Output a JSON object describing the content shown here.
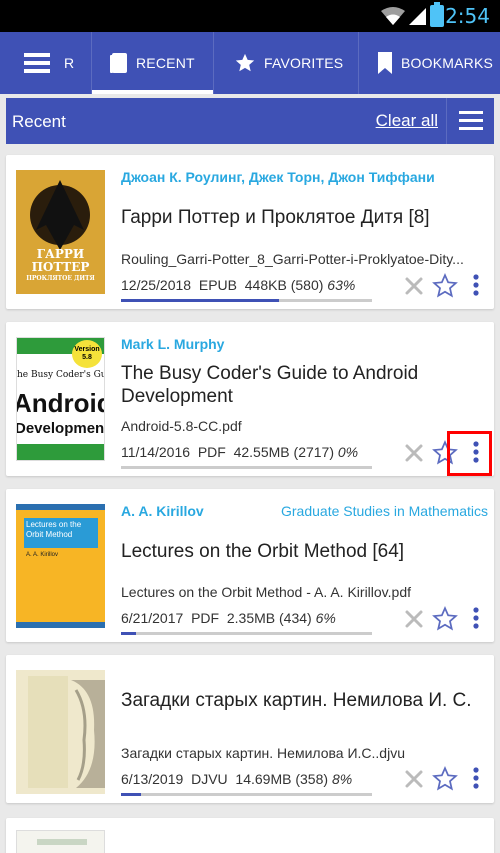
{
  "status_bar": {
    "time": "2:54"
  },
  "tabs": [
    {
      "label": "R"
    },
    {
      "label": "RECENT"
    },
    {
      "label": "FAVORITES"
    },
    {
      "label": "BOOKMARKS"
    }
  ],
  "header": {
    "title": "Recent",
    "clear_label": "Clear all"
  },
  "books": [
    {
      "author": "Джоан К. Роулинг, Джек Торн, Джон Тиффани",
      "series": "",
      "title": "Гарри Поттер и Проклятое Дитя [8]",
      "filename": "Rouling_Garri-Potter_8_Garri-Potter-i-Proklyatoe-Dity...",
      "date": "12/25/2018",
      "format": "EPUB",
      "size": "448KB",
      "pages": "(580)",
      "percent": "63%",
      "progress": 0.63,
      "cover_text": [
        "ГАРРИ",
        "ПОТТЕР",
        "ПРОКЛЯТОЕ ДИТЯ"
      ]
    },
    {
      "author": "Mark L. Murphy",
      "series": "",
      "title": "The Busy Coder's Guide to Android Development",
      "filename": "Android-5.8-CC.pdf",
      "date": "11/14/2016",
      "format": "PDF",
      "size": "42.55MB",
      "pages": "(2717)",
      "percent": "0%",
      "progress": 0.0,
      "cover_text": [
        "Version 5.8",
        "The Busy Coder's Guide",
        "Android",
        "Development"
      ]
    },
    {
      "author": "A. A. Kirillov",
      "series": "Graduate Studies in Mathematics",
      "title": "Lectures on the Orbit Method [64]",
      "filename": "Lectures on the Orbit Method - A. A. Kirillov.pdf",
      "date": "6/21/2017",
      "format": "PDF",
      "size": "2.35MB",
      "pages": "(434)",
      "percent": "6%",
      "progress": 0.06,
      "cover_text": [
        "Lectures on the Orbit Method",
        "A. A. Kirillov"
      ]
    },
    {
      "author": "",
      "series": "",
      "title": "Загадки старых картин. Немилова И. С.",
      "filename": "Загадки старых картин. Немилова И.С..djvu",
      "date": "6/13/2019",
      "format": "DJVU",
      "size": "14.69MB",
      "pages": "(358)",
      "percent": "8%",
      "progress": 0.08,
      "cover_text": []
    }
  ],
  "colors": {
    "primary": "#3f51b5",
    "accent": "#29a8e0",
    "highlight": "#ff0000"
  }
}
